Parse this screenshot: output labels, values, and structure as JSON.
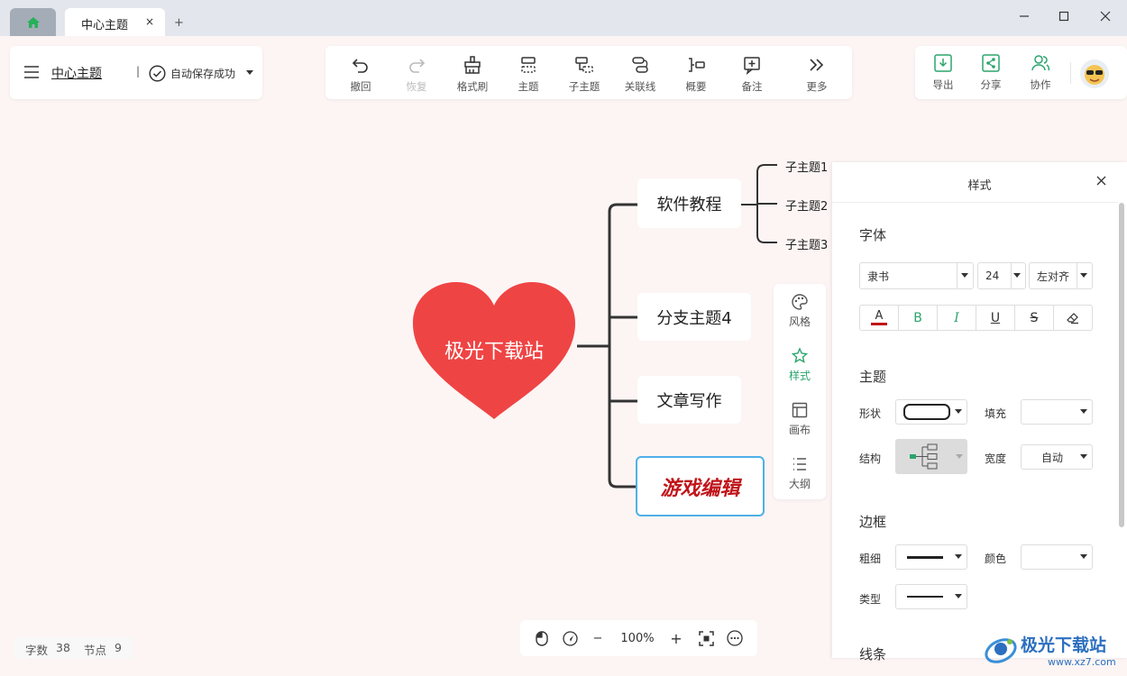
{
  "window": {
    "tab_title": "中心主题",
    "tab_close": "×",
    "new_tab": "+"
  },
  "header": {
    "doc_title": "中心主题",
    "separator": "|",
    "save_status": "自动保存成功"
  },
  "toolbar": [
    {
      "label": "撤回",
      "icon": "undo-icon",
      "enabled": true
    },
    {
      "label": "恢复",
      "icon": "redo-icon",
      "enabled": false
    },
    {
      "label": "格式刷",
      "icon": "format-brush-icon",
      "enabled": true
    },
    {
      "label": "主题",
      "icon": "topic-icon",
      "enabled": true
    },
    {
      "label": "子主题",
      "icon": "subtopic-icon",
      "enabled": true
    },
    {
      "label": "关联线",
      "icon": "relation-line-icon",
      "enabled": true
    },
    {
      "label": "概要",
      "icon": "summary-icon",
      "enabled": true
    },
    {
      "label": "备注",
      "icon": "note-icon",
      "enabled": true
    },
    {
      "label": "更多",
      "icon": "more-icon",
      "enabled": true
    }
  ],
  "right_actions": [
    {
      "label": "导出",
      "icon": "export-icon"
    },
    {
      "label": "分享",
      "icon": "share-icon"
    },
    {
      "label": "协作",
      "icon": "collaborate-icon"
    }
  ],
  "mindmap": {
    "central": "极光下载站",
    "central_color": "#ef4444",
    "branches": [
      "软件教程",
      "分支主题4",
      "文章写作",
      "游戏编辑"
    ],
    "subtopics": [
      "子主题1",
      "子主题2",
      "子主题3"
    ],
    "selected_color": "#c0151a"
  },
  "side_tabs": [
    {
      "label": "风格",
      "icon": "palette-icon",
      "active": false
    },
    {
      "label": "样式",
      "icon": "style-icon",
      "active": true
    },
    {
      "label": "画布",
      "icon": "canvas-icon",
      "active": false
    },
    {
      "label": "大纲",
      "icon": "outline-icon",
      "active": false
    }
  ],
  "style_panel": {
    "title": "样式",
    "font_section": "字体",
    "font_family": "隶书",
    "font_size": "24",
    "align": "左对齐",
    "format_buttons": [
      "B",
      "I",
      "U",
      "S"
    ],
    "topic_section": "主题",
    "shape_label": "形状",
    "fill_label": "填充",
    "structure_label": "结构",
    "width_label": "宽度",
    "width_value": "自动",
    "border_section": "边框",
    "thickness_label": "粗细",
    "color_label": "颜色",
    "type_label": "类型",
    "line_section": "线条"
  },
  "status": {
    "word_count_label": "字数",
    "word_count": "38",
    "node_count_label": "节点",
    "node_count": "9"
  },
  "zoom": {
    "value": "100%",
    "minus": "−",
    "plus": "+"
  },
  "watermark": {
    "text": "极光下载站",
    "url": "www.xz7.com"
  },
  "accent": "#2aa56c"
}
